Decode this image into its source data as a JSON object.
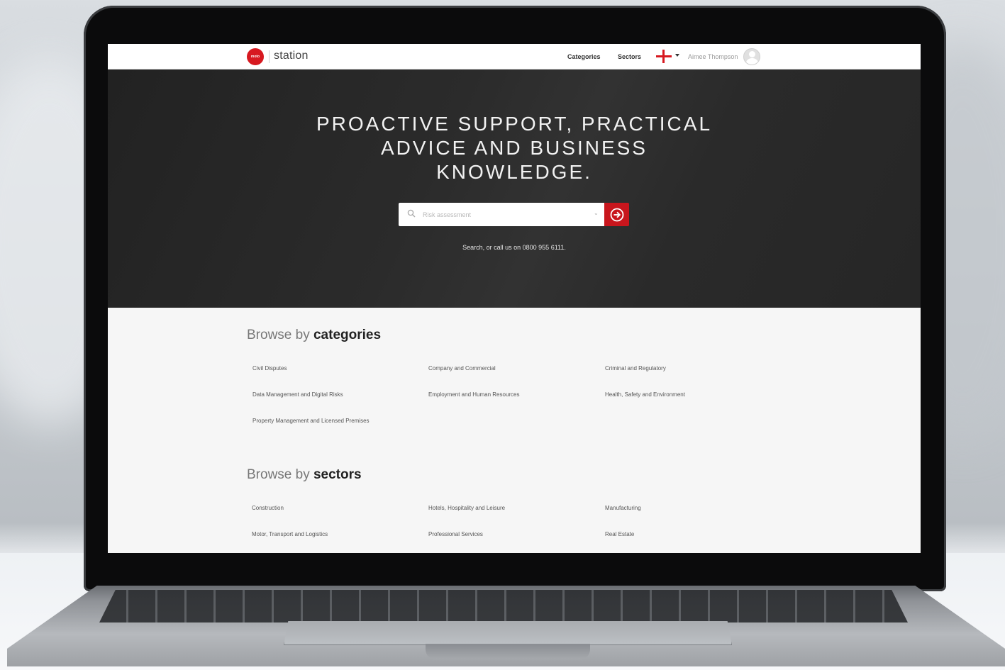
{
  "header": {
    "logo_badge": "moto",
    "logo_text": "station",
    "nav_categories": "Categories",
    "nav_sectors": "Sectors",
    "user_name": "Aimee Thompson"
  },
  "hero": {
    "title_line1": "PROACTIVE SUPPORT, PRACTICAL",
    "title_line2": "ADVICE AND BUSINESS",
    "title_line3": "KNOWLEDGE.",
    "search_placeholder": "Risk assessment",
    "help_text": "Search, or call us on 0800 955 6111."
  },
  "categories": {
    "heading_prefix": "Browse by ",
    "heading_bold": "categories",
    "items": [
      "Civil Disputes",
      "Company and Commercial",
      "Criminal and Regulatory",
      "Data Management and Digital Risks",
      "Employment and Human Resources",
      "Health, Safety and Environment",
      "Property Management and Licensed Premises"
    ]
  },
  "sectors": {
    "heading_prefix": "Browse by ",
    "heading_bold": "sectors",
    "items": [
      "Construction",
      "Hotels, Hospitality and Leisure",
      "Manufacturing",
      "Motor, Transport and Logistics",
      "Professional Services",
      "Real Estate"
    ]
  },
  "colors": {
    "accent": "#c8161d",
    "hero_bg": "#2a2a2a",
    "page_bg": "#f6f6f6"
  },
  "icons": {
    "search": "search-icon",
    "go": "arrow-right-circle-icon",
    "flag": "england-flag-icon",
    "avatar": "user-avatar-icon"
  }
}
